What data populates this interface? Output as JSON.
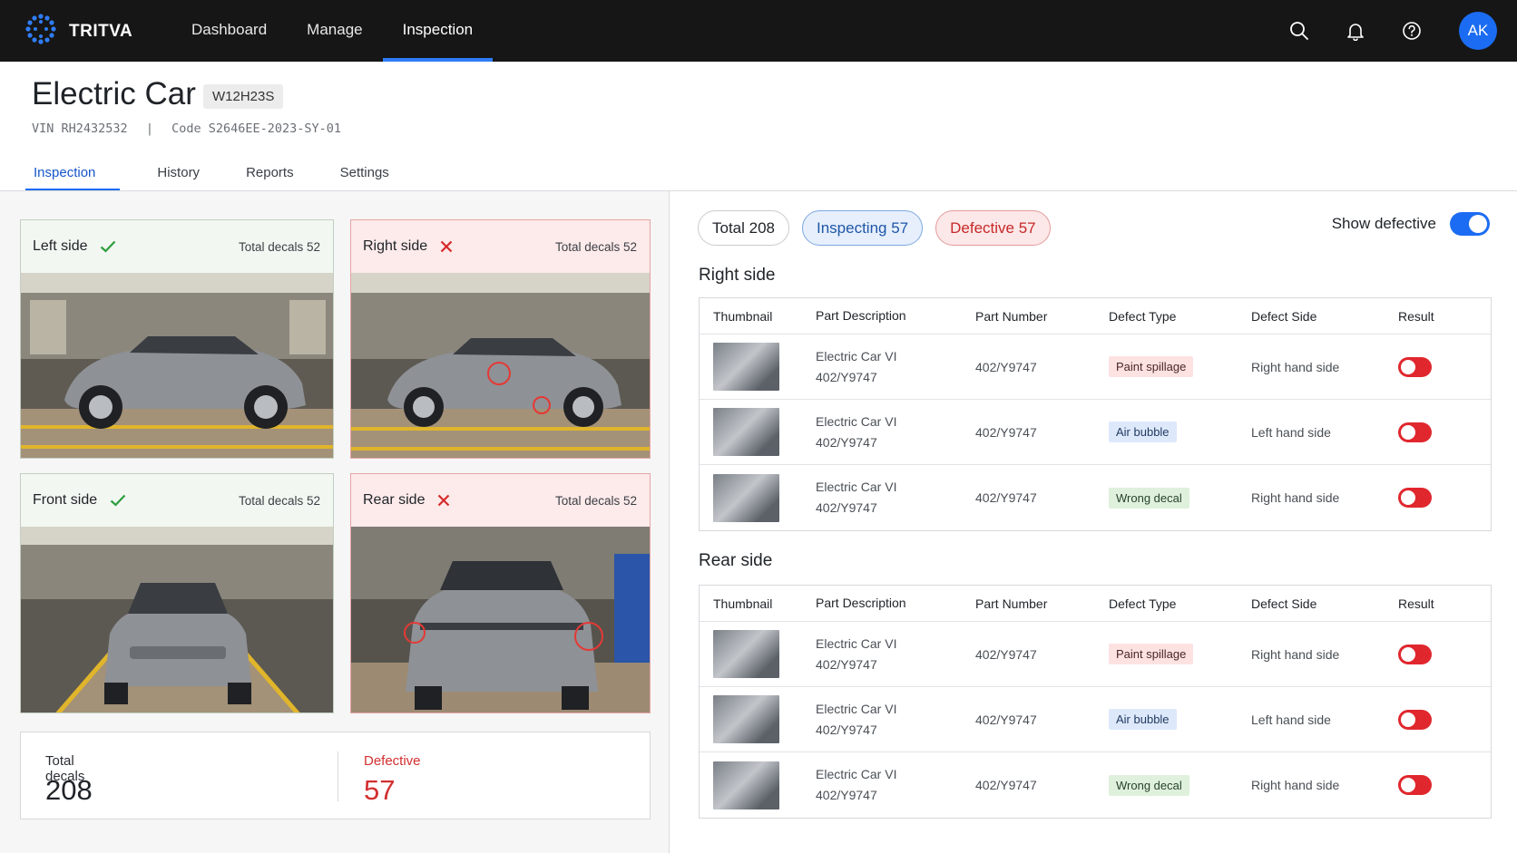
{
  "app": {
    "brand": "TRITVA"
  },
  "nav": [
    {
      "label": "Dashboard"
    },
    {
      "label": "Manage"
    },
    {
      "label": "Inspection"
    }
  ],
  "user": {
    "initials": "AK"
  },
  "header": {
    "title": "Electric Car",
    "badge": "W12H23S",
    "vin_label": "VIN",
    "vin": "RH2432532",
    "code_label": "Code",
    "code": "S2646EE-2023-SY-01"
  },
  "tabs": [
    {
      "label": "Inspection"
    },
    {
      "label": "History"
    },
    {
      "label": "Reports"
    },
    {
      "label": "Settings"
    }
  ],
  "cards": [
    {
      "title": "Left side",
      "status": "pass",
      "count": "Total decals 52"
    },
    {
      "title": "Right side",
      "status": "fail",
      "count": "Total decals 52"
    },
    {
      "title": "Front side",
      "status": "pass",
      "count": "Total decals 52"
    },
    {
      "title": "Rear side",
      "status": "fail",
      "count": "Total decals 52"
    }
  ],
  "summary": {
    "total_label": "Total decals",
    "total_value": "208",
    "defective_label": "Defective",
    "defective_value": "57"
  },
  "filters": {
    "total": "Total 208",
    "inspecting": "Inspecting 57",
    "defective": "Defective 57",
    "show_defective": "Show defective"
  },
  "columns": [
    "Thumbnail",
    "Part Description",
    "Part Number",
    "Defect Type",
    "Defect Side",
    "Result"
  ],
  "sections": [
    {
      "title": "Right side",
      "rows": [
        {
          "desc1": "Electric Car VI",
          "desc2": "402/Y9747",
          "part": "402/Y9747",
          "type": "Paint spillage",
          "side": "Right hand side"
        },
        {
          "desc1": "Electric Car VI",
          "desc2": "402/Y9747",
          "part": "402/Y9747",
          "type": "Air bubble",
          "side": "Left hand side"
        },
        {
          "desc1": "Electric Car VI",
          "desc2": "402/Y9747",
          "part": "402/Y9747",
          "type": "Wrong decal",
          "side": "Right hand side"
        }
      ]
    },
    {
      "title": "Rear side",
      "rows": [
        {
          "desc1": "Electric Car VI",
          "desc2": "402/Y9747",
          "part": "402/Y9747",
          "type": "Paint spillage",
          "side": "Right hand side"
        },
        {
          "desc1": "Electric Car VI",
          "desc2": "402/Y9747",
          "part": "402/Y9747",
          "type": "Air bubble",
          "side": "Left hand side"
        },
        {
          "desc1": "Electric Car VI",
          "desc2": "402/Y9747",
          "part": "402/Y9747",
          "type": "Wrong decal",
          "side": "Right hand side"
        }
      ]
    }
  ],
  "colors": {
    "accent": "#1b6cf2",
    "danger": "#e0272e",
    "topbar": "#161616"
  },
  "icons": [
    "tritva-logo-icon",
    "search-icon",
    "bell-icon",
    "help-icon",
    "check-icon",
    "cross-icon"
  ]
}
